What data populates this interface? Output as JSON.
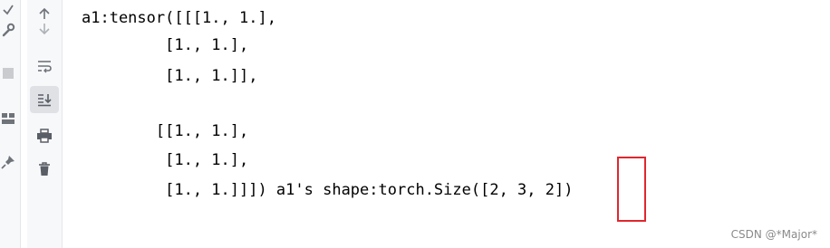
{
  "console": {
    "lines": [
      "a1:tensor([[[1., 1.],",
      "         [1., 1.],",
      "         [1., 1.]],",
      "",
      "        [[1., 1.],",
      "         [1., 1.],",
      "         [1., 1.]]]) a1's shape:torch.Size([2, 3, 2])"
    ]
  },
  "toolbar": {
    "buttons": [
      {
        "name": "scroll-up-icon",
        "active": false
      },
      {
        "name": "scroll-down-icon",
        "active": false
      },
      {
        "name": "soft-wrap-icon",
        "active": false
      },
      {
        "name": "scroll-to-end-icon",
        "active": true
      },
      {
        "name": "print-icon",
        "active": false
      },
      {
        "name": "trash-icon",
        "active": false
      }
    ]
  },
  "left_strip": {
    "icons": [
      "settings-check-icon",
      "wrench-icon",
      "stop-icon",
      "layout-icon",
      "pin-icon"
    ]
  },
  "watermark": "CSDN @*Major*",
  "colors": {
    "highlight": "#e0272f",
    "toolbar_bg": "#f7f8fa",
    "active_button_bg": "#dfe1e5"
  }
}
